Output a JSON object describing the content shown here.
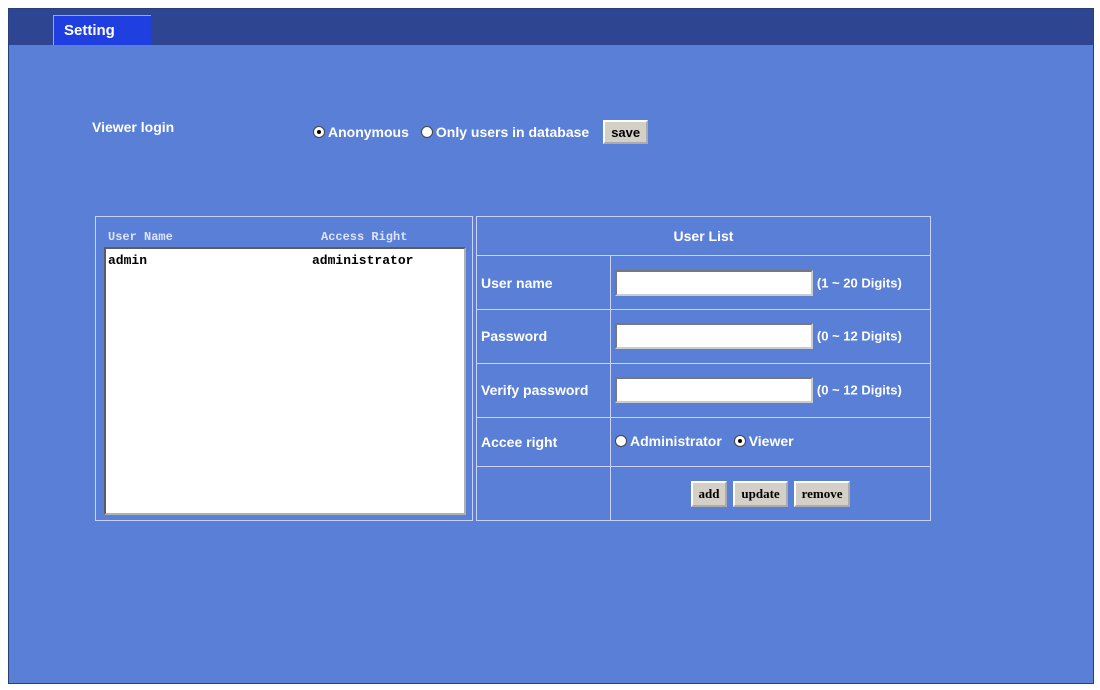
{
  "tab": {
    "label": "Setting"
  },
  "viewer_login": {
    "label": "Viewer login",
    "options": [
      {
        "label": "Anonymous",
        "selected": true
      },
      {
        "label": "Only users in database",
        "selected": false
      }
    ],
    "save_label": "save"
  },
  "user_table": {
    "columns": [
      "User Name",
      "Access Right"
    ],
    "rows": [
      {
        "name": "admin",
        "access": "administrator"
      }
    ]
  },
  "form": {
    "title": "User List",
    "username": {
      "label": "User name",
      "value": "",
      "hint": "(1 ~ 20 Digits)"
    },
    "password": {
      "label": "Password",
      "value": "",
      "hint": "(0 ~ 12 Digits)"
    },
    "verify": {
      "label": "Verify password",
      "value": "",
      "hint": "(0 ~ 12 Digits)"
    },
    "access": {
      "label": "Accee right",
      "options": [
        {
          "label": "Administrator",
          "selected": false
        },
        {
          "label": "Viewer",
          "selected": true
        }
      ]
    },
    "buttons": {
      "add": "add",
      "update": "update",
      "remove": "remove"
    }
  }
}
